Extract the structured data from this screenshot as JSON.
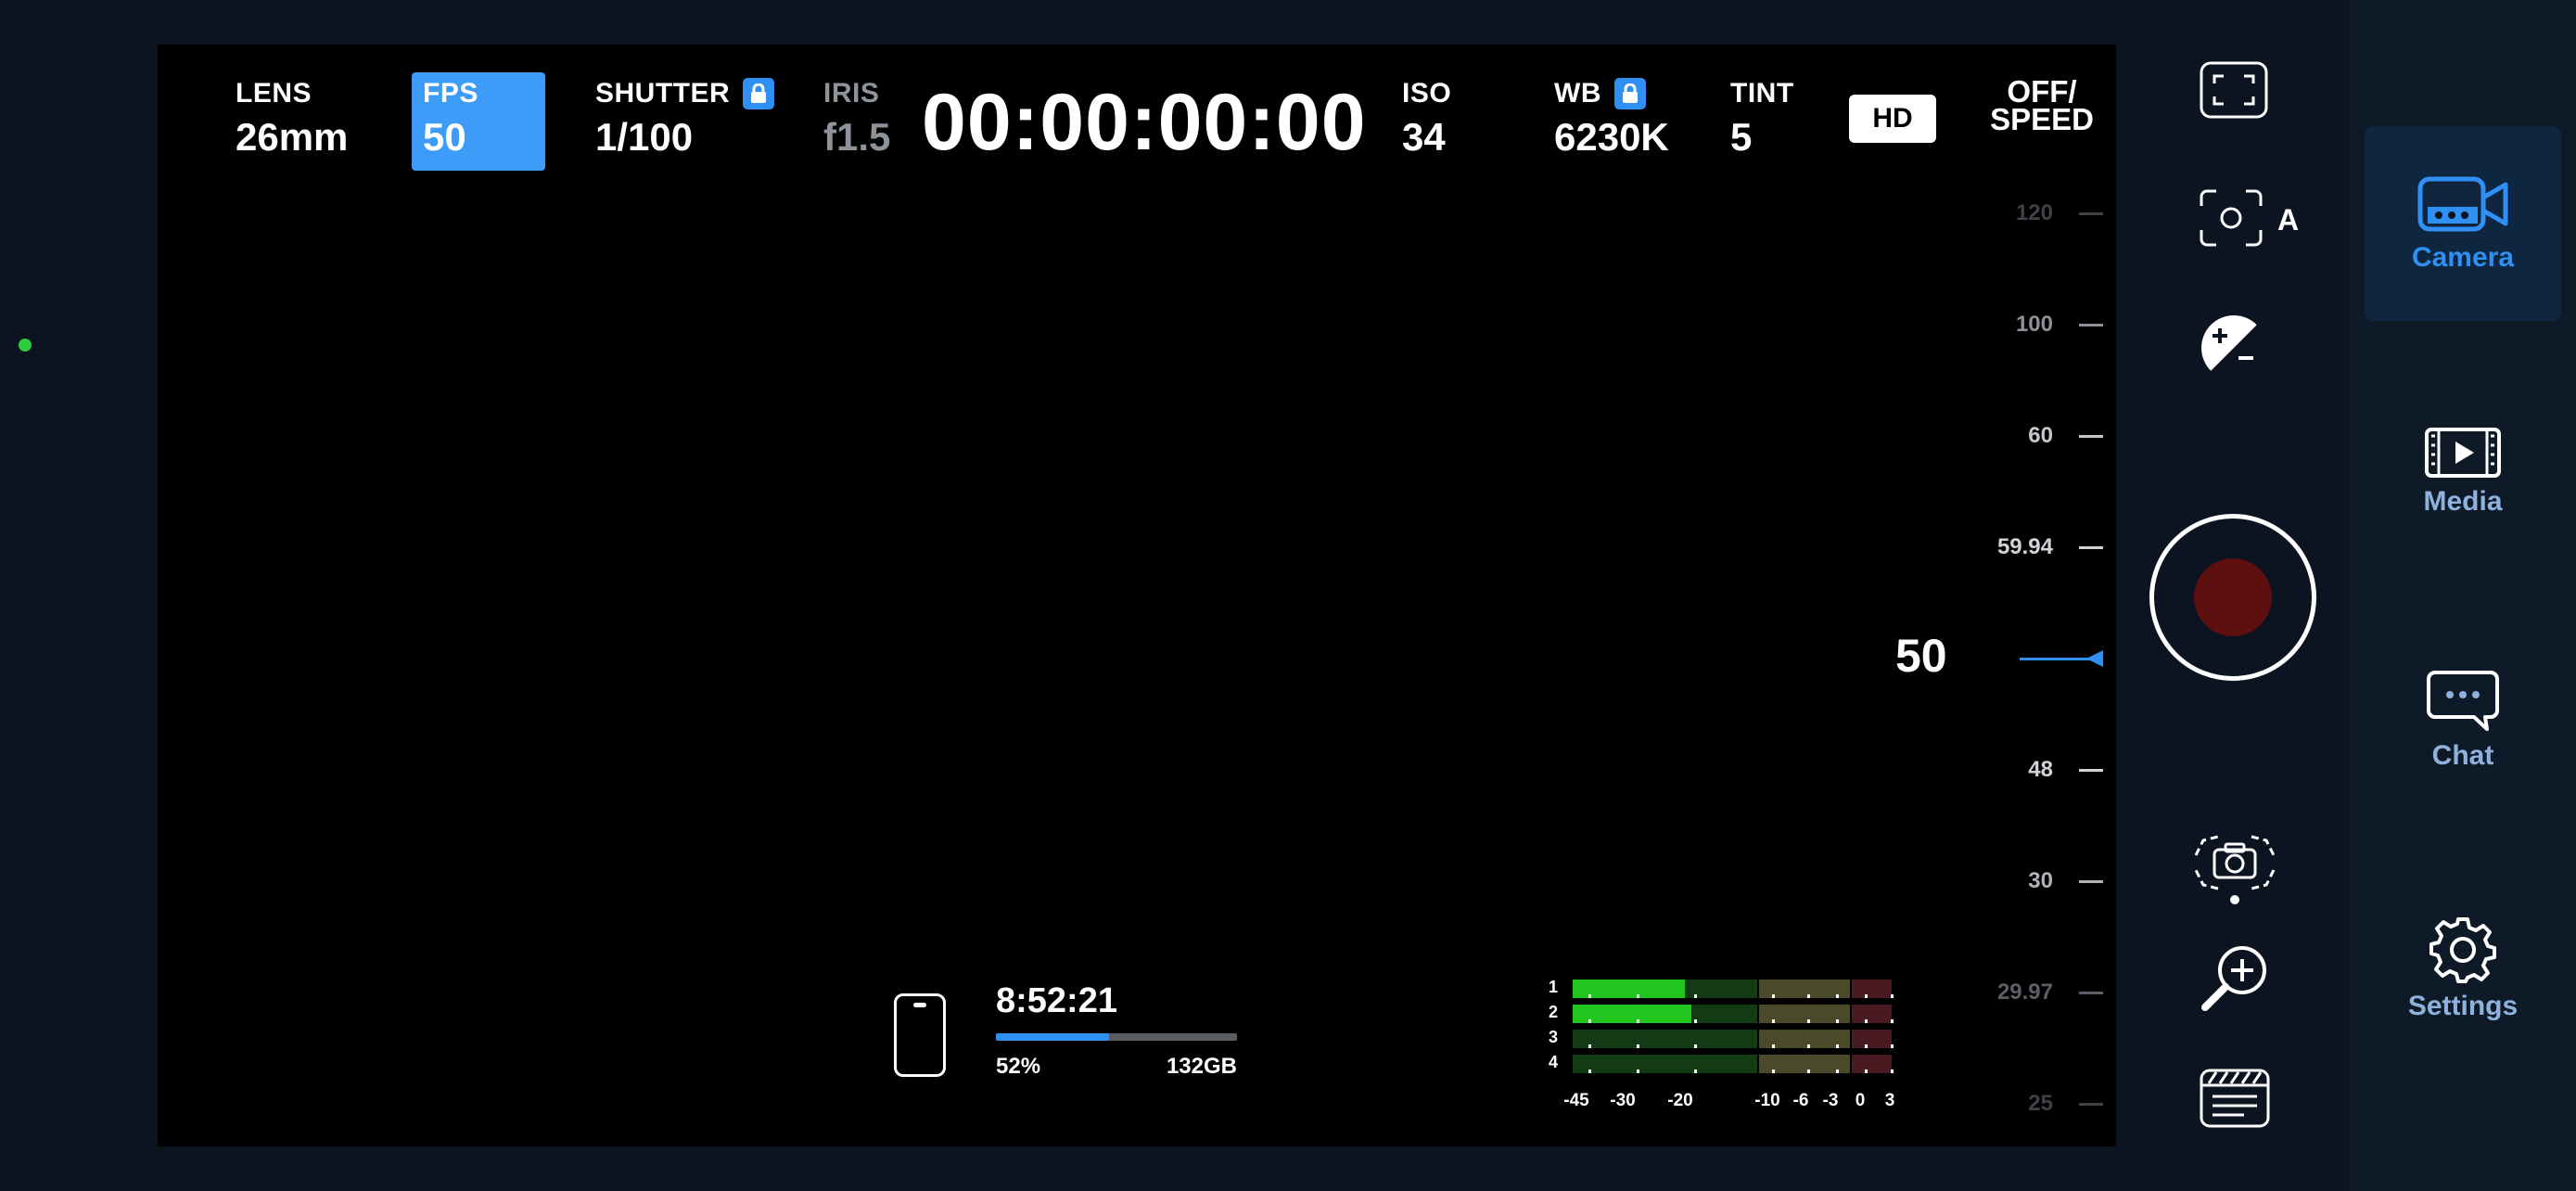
{
  "hud": {
    "lens": {
      "label": "LENS",
      "value": "26mm"
    },
    "fps": {
      "label": "FPS",
      "value": "50"
    },
    "shutter": {
      "label": "SHUTTER",
      "value": "1/100"
    },
    "iris": {
      "label": "IRIS",
      "value": "f1.5"
    },
    "timecode": "00:00:00:00",
    "iso": {
      "label": "ISO",
      "value": "34"
    },
    "wb": {
      "label": "WB",
      "value": "6230K"
    },
    "tint": {
      "label": "TINT",
      "value": "5"
    },
    "resolution_badge": "HD",
    "offspeed_line1": "OFF/",
    "offspeed_line2": "SPEED"
  },
  "fps_scale": {
    "labels": [
      "120",
      "100",
      "60",
      "59.94",
      "48",
      "30",
      "29.97",
      "25"
    ],
    "current": "50"
  },
  "storage": {
    "remaining_time": "8:52:21",
    "percent_label": "52%",
    "fill_fraction": 0.47,
    "capacity": "132GB"
  },
  "audio_meter": {
    "channels": [
      "1",
      "2",
      "3",
      "4"
    ],
    "levels_fraction": [
      0.35,
      0.37,
      0,
      0
    ],
    "scale": [
      "-45",
      "-30",
      "-20",
      "-10",
      "-6",
      "-3",
      "0",
      "3"
    ]
  },
  "controls": {
    "icons": [
      "fullscreen-icon",
      "auto-focus-icon",
      "exposure-compensation-icon",
      "record-button",
      "camera-stabilizer-icon",
      "zoom-in-icon",
      "clapperboard-icon"
    ]
  },
  "nav": {
    "camera": "Camera",
    "media": "Media",
    "chat": "Chat",
    "settings": "Settings",
    "active": "Camera"
  },
  "colors": {
    "accent": "#2f8ff2",
    "fps_highlight": "#3d9cf8",
    "record": "#5e0f0f",
    "meter_green": "#21c71e",
    "status_dot": "#2ecc40"
  }
}
